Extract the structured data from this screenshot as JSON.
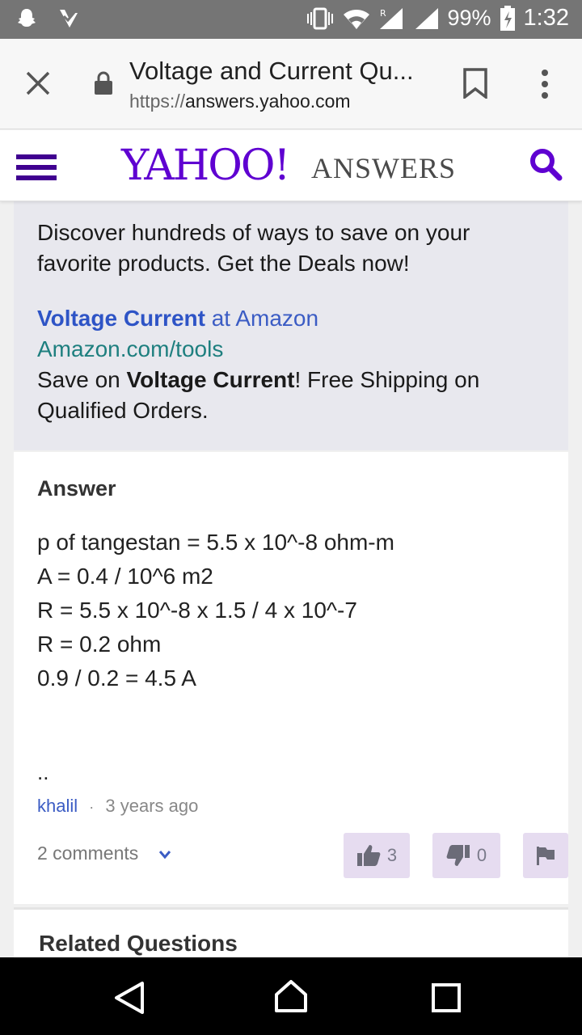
{
  "status_bar": {
    "battery": "99%",
    "time": "1:32",
    "icons": [
      "snapchat-icon",
      "checkmark-app-icon",
      "vibrate-icon",
      "wifi-icon",
      "signal-roaming-icon",
      "signal-icon",
      "battery-charging-icon"
    ]
  },
  "browser": {
    "page_title": "Voltage and Current Qu...",
    "url_scheme": "https://",
    "url_host": "answers.yahoo.com"
  },
  "header": {
    "logo": "YAHOO!",
    "section": "ANSWERS"
  },
  "ad": {
    "description": "Discover hundreds of ways to save on your favorite products. Get the Deals now!",
    "headline_bold": "Voltage Current",
    "headline_rest": " at Amazon",
    "link": "Amazon.com/tools",
    "text_before": "Save on ",
    "text_bold": "Voltage Current",
    "text_after": "! Free Shipping on Qualified Orders."
  },
  "answer": {
    "label": "Answer",
    "lines": [
      "p of tangestan = 5.5 x 10^-8 ohm-m",
      "A = 0.4 / 10^6 m2",
      "R = 5.5 x 10^-8 x 1.5 / 4 x 10^-7",
      "R = 0.2 ohm",
      "0.9 / 0.2 = 4.5 A"
    ],
    "trailing": "..",
    "author": "khalil",
    "separator": "·",
    "time_ago": "3 years ago",
    "comments": "2 comments",
    "thumbs_up_count": "3",
    "thumbs_down_count": "0"
  },
  "related": {
    "title": "Related Questions"
  }
}
